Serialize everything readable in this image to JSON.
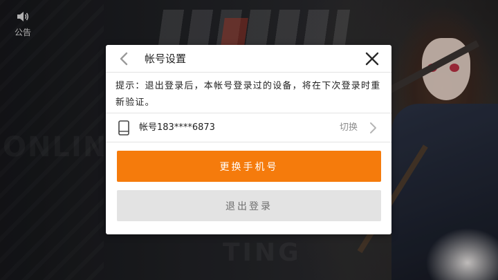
{
  "background": {
    "notice_label": "公告"
  },
  "dialog": {
    "title": "帐号设置",
    "tip": "提示：退出登录后，本帐号登录过的设备，将在下次登录时重新验证。",
    "account_label": "帐号183****6873",
    "switch_label": "切换",
    "change_phone_button": "更换手机号",
    "logout_button": "退出登录"
  },
  "colors": {
    "primary_button": "#f57b0c",
    "secondary_button": "#e3e3e3",
    "dialog_background": "#ffffff",
    "divider": "#e2e2e2"
  },
  "icons": {
    "notice": "speaker-icon",
    "back": "chevron-left-icon",
    "close": "close-icon",
    "account": "phone-icon",
    "switch": "chevron-right-icon"
  }
}
